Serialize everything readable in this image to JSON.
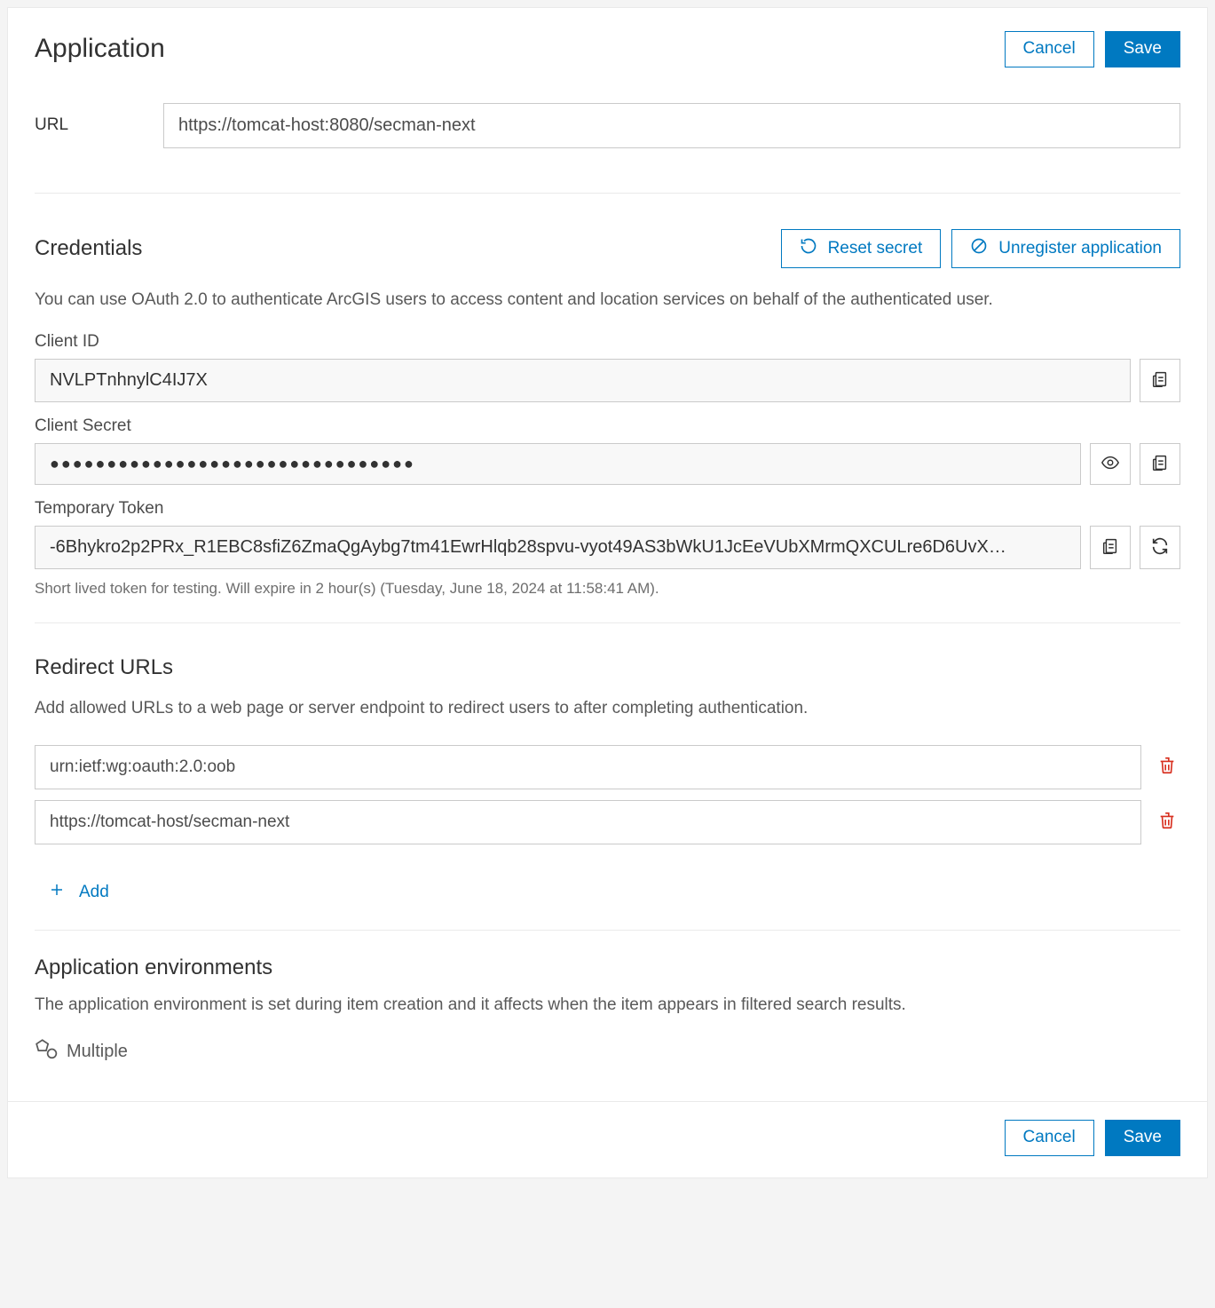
{
  "header": {
    "title": "Application",
    "cancel_label": "Cancel",
    "save_label": "Save"
  },
  "url_section": {
    "label": "URL",
    "value": "https://tomcat-host:8080/secman-next"
  },
  "credentials": {
    "title": "Credentials",
    "reset_label": "Reset secret",
    "unregister_label": "Unregister application",
    "description": "You can use OAuth 2.0 to authenticate ArcGIS users to access content and location services on behalf of the authenticated user.",
    "client_id_label": "Client ID",
    "client_id_value": "NVLPTnhnylC4IJ7X",
    "client_secret_label": "Client Secret",
    "client_secret_masked": "●●●●●●●●●●●●●●●●●●●●●●●●●●●●●●●●",
    "temp_token_label": "Temporary Token",
    "temp_token_value": "-6Bhykro2p2PRx_R1EBC8sfiZ6ZmaQgAybg7tm41EwrHlqb28spvu-vyot49AS3bWkU1JcEeVUbXMrmQXCULre6D6UvX…",
    "temp_token_hint": "Short lived token for testing. Will expire in 2 hour(s) (Tuesday, June 18, 2024 at 11:58:41 AM)."
  },
  "redirect": {
    "title": "Redirect URLs",
    "description": "Add allowed URLs to a web page or server endpoint to redirect users to after completing authentication.",
    "items": [
      "urn:ietf:wg:oauth:2.0:oob",
      "https://tomcat-host/secman-next"
    ],
    "add_label": "Add"
  },
  "environments": {
    "title": "Application environments",
    "description": "The application environment is set during item creation and it affects when the item appears in filtered search results.",
    "value": "Multiple"
  },
  "footer": {
    "cancel_label": "Cancel",
    "save_label": "Save"
  }
}
